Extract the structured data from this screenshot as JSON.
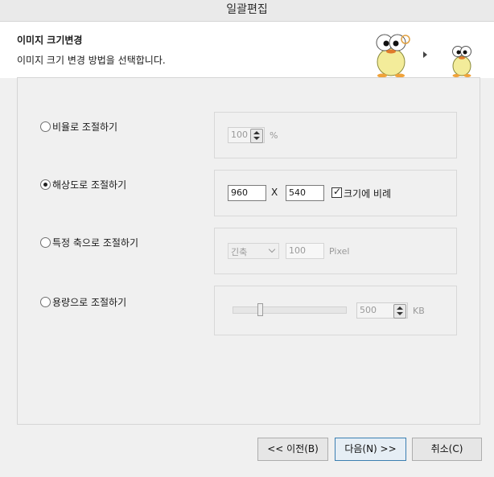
{
  "window": {
    "title": "일괄편집"
  },
  "header": {
    "title": "이미지 크기변경",
    "subtitle": "이미지 크기 변경 방법을 선택합니다."
  },
  "options": [
    {
      "label": "비율로 조절하기",
      "selected": false
    },
    {
      "label": "해상도로 조절하기",
      "selected": true
    },
    {
      "label": "특정 축으로 조절하기",
      "selected": false
    },
    {
      "label": "용량으로 조절하기",
      "selected": false
    }
  ],
  "ratio": {
    "value": "100",
    "unit": "%"
  },
  "resolution": {
    "width": "960",
    "separator": "X",
    "height": "540",
    "proportional_label": "크기에 비례",
    "proportional_checked": true
  },
  "axis": {
    "selected": "긴축",
    "value": "100",
    "unit": "Pixel"
  },
  "capacity": {
    "value": "500",
    "unit": "KB",
    "slider_level_percent": 24
  },
  "buttons": {
    "prev": "<< 이전(B)",
    "next": "다음(N) >>",
    "cancel": "취소(C)"
  },
  "icons": [
    "mascot-large-icon",
    "arrow-right-icon",
    "mascot-small-icon",
    "spin-up-icon",
    "spin-down-icon",
    "dropdown-chevron-icon",
    "checkmark-icon"
  ]
}
